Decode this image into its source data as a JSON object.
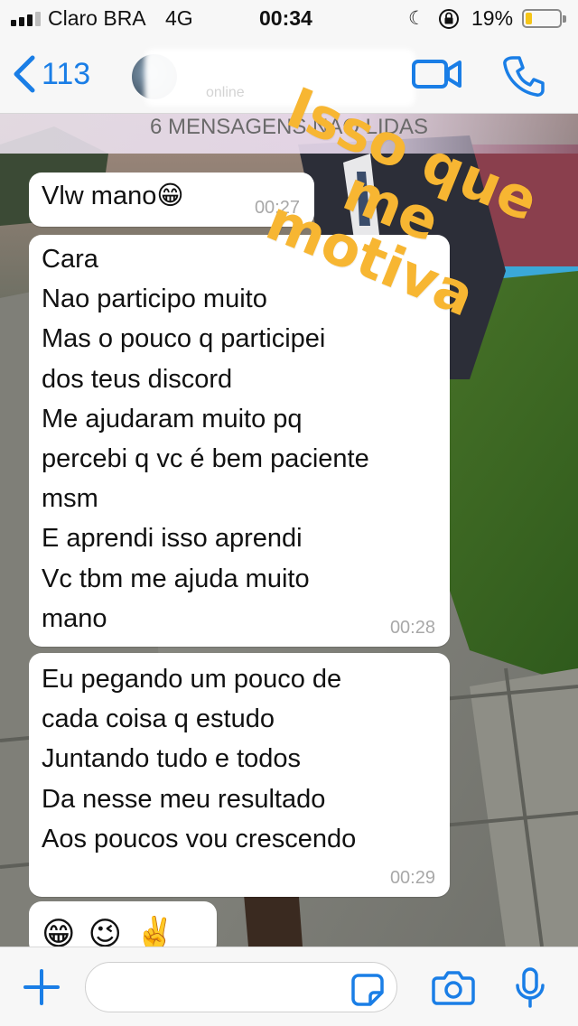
{
  "status_bar": {
    "carrier": "Claro BRA",
    "network": "4G",
    "time": "00:34",
    "battery": "19%",
    "battery_level": 0.19,
    "icons": [
      "signal-icon",
      "moon-icon",
      "orientation-lock-icon",
      "battery-icon"
    ]
  },
  "nav": {
    "back_count": "113",
    "contact_status": "online",
    "icons": [
      "back-chevron-icon",
      "avatar",
      "video-camera-icon",
      "phone-icon"
    ]
  },
  "unread_banner": "6 MENSAGENS NAO LIDAS",
  "messages": [
    {
      "lines": [
        "Vlw mano😁"
      ],
      "time": "00:27"
    },
    {
      "lines": [
        "Cara",
        "Nao participo muito",
        "Mas o pouco q participei",
        "dos teus discord",
        "Me ajudaram muito pq",
        "percebi q vc é bem paciente",
        "msm",
        "E aprendi isso aprendi",
        "Vc tbm me ajuda muito",
        "mano"
      ],
      "time": "00:28"
    },
    {
      "lines": [
        "Eu pegando um pouco de",
        "cada coisa q estudo",
        "Juntando tudo e todos",
        "Da nesse meu resultado",
        "Aos poucos vou crescendo"
      ],
      "time": "00:29"
    },
    {
      "lines": [
        "😁😉✌️"
      ],
      "time": ""
    }
  ],
  "sticker": {
    "lines": [
      "Isso que me",
      "motiva"
    ],
    "color": "#f7b632"
  },
  "input_bar": {
    "placeholder": "",
    "icons": [
      "plus-icon",
      "sticker-icon",
      "camera-icon",
      "microphone-icon"
    ]
  },
  "colors": {
    "accent": "#1a7ee6",
    "bubble": "#ffffff",
    "bar": "#f7f7f7"
  }
}
